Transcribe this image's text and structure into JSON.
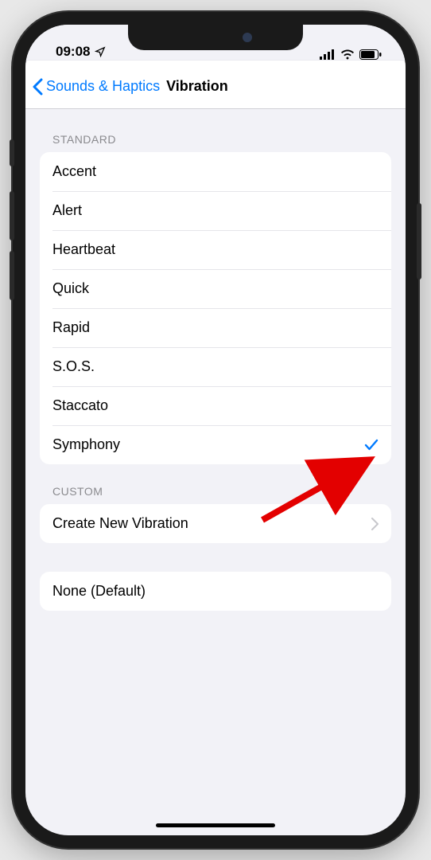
{
  "status": {
    "time": "09:08"
  },
  "nav": {
    "back_label": "Sounds & Haptics",
    "title": "Vibration"
  },
  "sections": {
    "standard_header": "STANDARD",
    "custom_header": "CUSTOM"
  },
  "standard_items": [
    {
      "label": "Accent",
      "selected": false
    },
    {
      "label": "Alert",
      "selected": false
    },
    {
      "label": "Heartbeat",
      "selected": false
    },
    {
      "label": "Quick",
      "selected": false
    },
    {
      "label": "Rapid",
      "selected": false
    },
    {
      "label": "S.O.S.",
      "selected": false
    },
    {
      "label": "Staccato",
      "selected": false
    },
    {
      "label": "Symphony",
      "selected": true
    }
  ],
  "custom": {
    "create_label": "Create New Vibration"
  },
  "none": {
    "label": "None (Default)"
  }
}
